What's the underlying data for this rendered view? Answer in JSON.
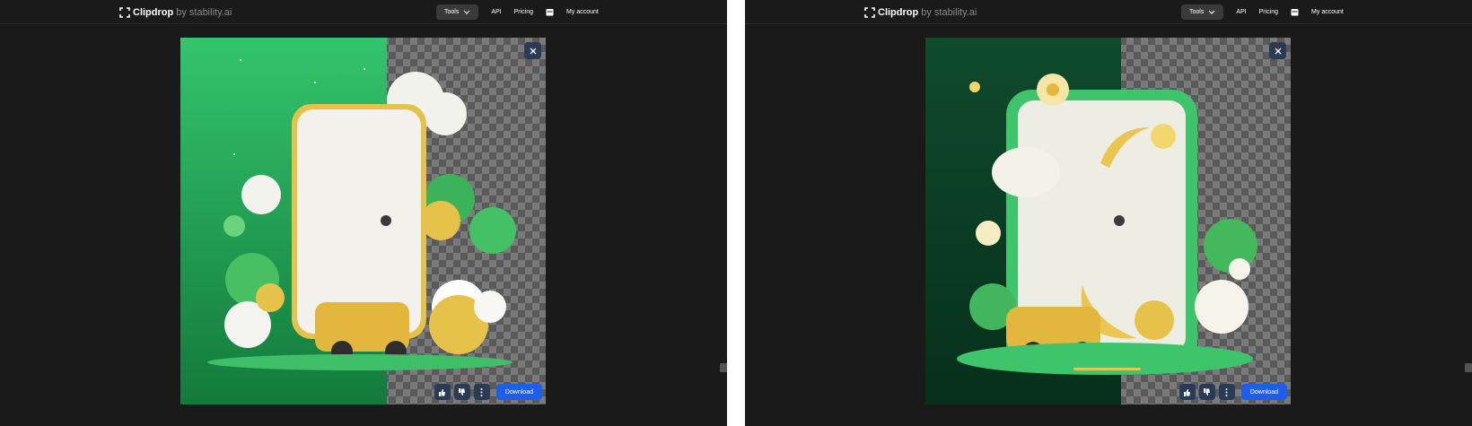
{
  "logo": {
    "brand": "Clipdrop",
    "by": "by stability.ai"
  },
  "nav": {
    "tools": "Tools",
    "api": "API",
    "pricing": "Pricing",
    "account": "My account"
  },
  "actions": {
    "download": "Download"
  },
  "icons": [
    "clipdrop-logo-icon",
    "chevron-down-icon",
    "calendar-icon",
    "close-icon",
    "thumbs-up-icon",
    "thumbs-down-icon",
    "more-vertical-icon"
  ],
  "colors": {
    "background": "#1a1a1a",
    "download": "#1d5fe8",
    "accent_green": "#2fb864",
    "gold": "#e7c24a"
  }
}
